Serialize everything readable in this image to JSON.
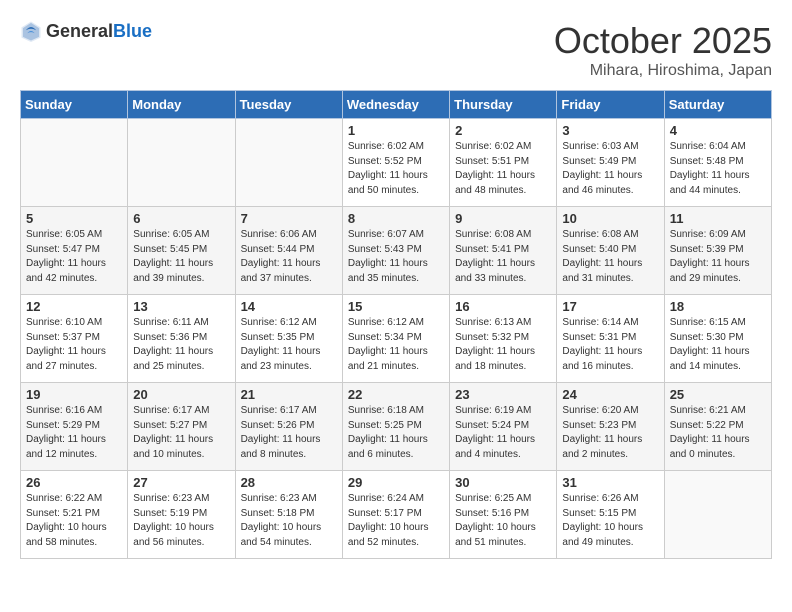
{
  "header": {
    "logo_general": "General",
    "logo_blue": "Blue",
    "month": "October 2025",
    "location": "Mihara, Hiroshima, Japan"
  },
  "weekdays": [
    "Sunday",
    "Monday",
    "Tuesday",
    "Wednesday",
    "Thursday",
    "Friday",
    "Saturday"
  ],
  "weeks": [
    [
      {
        "day": "",
        "info": ""
      },
      {
        "day": "",
        "info": ""
      },
      {
        "day": "",
        "info": ""
      },
      {
        "day": "1",
        "info": "Sunrise: 6:02 AM\nSunset: 5:52 PM\nDaylight: 11 hours\nand 50 minutes."
      },
      {
        "day": "2",
        "info": "Sunrise: 6:02 AM\nSunset: 5:51 PM\nDaylight: 11 hours\nand 48 minutes."
      },
      {
        "day": "3",
        "info": "Sunrise: 6:03 AM\nSunset: 5:49 PM\nDaylight: 11 hours\nand 46 minutes."
      },
      {
        "day": "4",
        "info": "Sunrise: 6:04 AM\nSunset: 5:48 PM\nDaylight: 11 hours\nand 44 minutes."
      }
    ],
    [
      {
        "day": "5",
        "info": "Sunrise: 6:05 AM\nSunset: 5:47 PM\nDaylight: 11 hours\nand 42 minutes."
      },
      {
        "day": "6",
        "info": "Sunrise: 6:05 AM\nSunset: 5:45 PM\nDaylight: 11 hours\nand 39 minutes."
      },
      {
        "day": "7",
        "info": "Sunrise: 6:06 AM\nSunset: 5:44 PM\nDaylight: 11 hours\nand 37 minutes."
      },
      {
        "day": "8",
        "info": "Sunrise: 6:07 AM\nSunset: 5:43 PM\nDaylight: 11 hours\nand 35 minutes."
      },
      {
        "day": "9",
        "info": "Sunrise: 6:08 AM\nSunset: 5:41 PM\nDaylight: 11 hours\nand 33 minutes."
      },
      {
        "day": "10",
        "info": "Sunrise: 6:08 AM\nSunset: 5:40 PM\nDaylight: 11 hours\nand 31 minutes."
      },
      {
        "day": "11",
        "info": "Sunrise: 6:09 AM\nSunset: 5:39 PM\nDaylight: 11 hours\nand 29 minutes."
      }
    ],
    [
      {
        "day": "12",
        "info": "Sunrise: 6:10 AM\nSunset: 5:37 PM\nDaylight: 11 hours\nand 27 minutes."
      },
      {
        "day": "13",
        "info": "Sunrise: 6:11 AM\nSunset: 5:36 PM\nDaylight: 11 hours\nand 25 minutes."
      },
      {
        "day": "14",
        "info": "Sunrise: 6:12 AM\nSunset: 5:35 PM\nDaylight: 11 hours\nand 23 minutes."
      },
      {
        "day": "15",
        "info": "Sunrise: 6:12 AM\nSunset: 5:34 PM\nDaylight: 11 hours\nand 21 minutes."
      },
      {
        "day": "16",
        "info": "Sunrise: 6:13 AM\nSunset: 5:32 PM\nDaylight: 11 hours\nand 18 minutes."
      },
      {
        "day": "17",
        "info": "Sunrise: 6:14 AM\nSunset: 5:31 PM\nDaylight: 11 hours\nand 16 minutes."
      },
      {
        "day": "18",
        "info": "Sunrise: 6:15 AM\nSunset: 5:30 PM\nDaylight: 11 hours\nand 14 minutes."
      }
    ],
    [
      {
        "day": "19",
        "info": "Sunrise: 6:16 AM\nSunset: 5:29 PM\nDaylight: 11 hours\nand 12 minutes."
      },
      {
        "day": "20",
        "info": "Sunrise: 6:17 AM\nSunset: 5:27 PM\nDaylight: 11 hours\nand 10 minutes."
      },
      {
        "day": "21",
        "info": "Sunrise: 6:17 AM\nSunset: 5:26 PM\nDaylight: 11 hours\nand 8 minutes."
      },
      {
        "day": "22",
        "info": "Sunrise: 6:18 AM\nSunset: 5:25 PM\nDaylight: 11 hours\nand 6 minutes."
      },
      {
        "day": "23",
        "info": "Sunrise: 6:19 AM\nSunset: 5:24 PM\nDaylight: 11 hours\nand 4 minutes."
      },
      {
        "day": "24",
        "info": "Sunrise: 6:20 AM\nSunset: 5:23 PM\nDaylight: 11 hours\nand 2 minutes."
      },
      {
        "day": "25",
        "info": "Sunrise: 6:21 AM\nSunset: 5:22 PM\nDaylight: 11 hours\nand 0 minutes."
      }
    ],
    [
      {
        "day": "26",
        "info": "Sunrise: 6:22 AM\nSunset: 5:21 PM\nDaylight: 10 hours\nand 58 minutes."
      },
      {
        "day": "27",
        "info": "Sunrise: 6:23 AM\nSunset: 5:19 PM\nDaylight: 10 hours\nand 56 minutes."
      },
      {
        "day": "28",
        "info": "Sunrise: 6:23 AM\nSunset: 5:18 PM\nDaylight: 10 hours\nand 54 minutes."
      },
      {
        "day": "29",
        "info": "Sunrise: 6:24 AM\nSunset: 5:17 PM\nDaylight: 10 hours\nand 52 minutes."
      },
      {
        "day": "30",
        "info": "Sunrise: 6:25 AM\nSunset: 5:16 PM\nDaylight: 10 hours\nand 51 minutes."
      },
      {
        "day": "31",
        "info": "Sunrise: 6:26 AM\nSunset: 5:15 PM\nDaylight: 10 hours\nand 49 minutes."
      },
      {
        "day": "",
        "info": ""
      }
    ]
  ]
}
